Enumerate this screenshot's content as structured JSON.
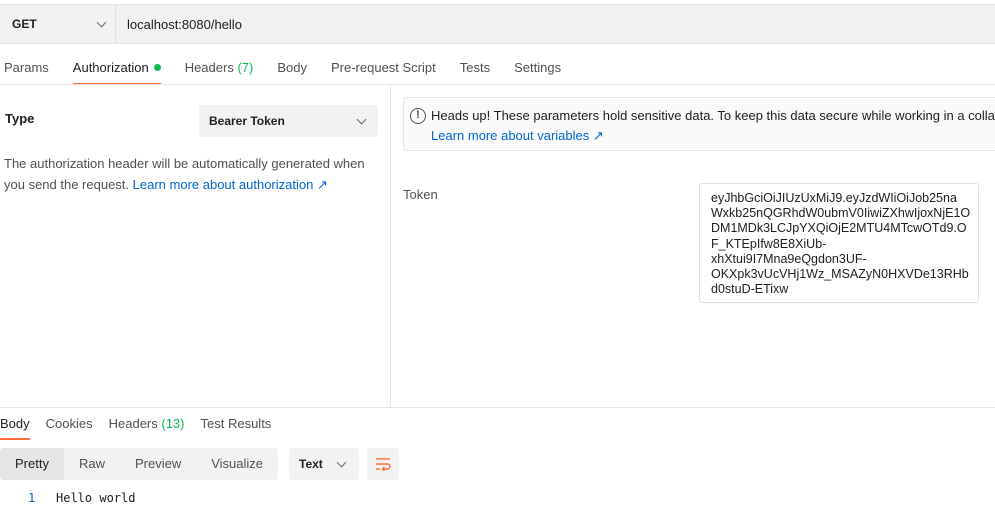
{
  "request": {
    "method": "GET",
    "url": "localhost:8080/hello"
  },
  "request_tabs": [
    {
      "label": "Params",
      "count": ""
    },
    {
      "label": "Authorization",
      "count": ""
    },
    {
      "label": "Headers",
      "count": "(7)"
    },
    {
      "label": "Body",
      "count": ""
    },
    {
      "label": "Pre-request Script",
      "count": ""
    },
    {
      "label": "Tests",
      "count": ""
    },
    {
      "label": "Settings",
      "count": ""
    }
  ],
  "auth": {
    "type_label": "Type",
    "type_value": "Bearer Token",
    "description": "The authorization header will be automatically generated when you send the request.",
    "description_link": "Learn more about authorization ↗"
  },
  "warning": {
    "text": "Heads up! These parameters hold sensitive data. To keep this data secure while working in a collabo",
    "link": "Learn more about variables ↗"
  },
  "token": {
    "label": "Token",
    "lines": [
      "eyJhbGciOiJIUzUxMiJ9.eyJzdWIiOiJob25na",
      "Wxkb25nQGRhdW0ubmV0IiwiZXhwIjoxNjE1O",
      "DM1MDk3LCJpYXQiOjE2MTU4MTcwOTd9.O",
      "F_KTEpIfw8E8XiUb-",
      "xhXtui9I7Mna9eQgdon3UF-",
      "OKXpk3vUcVHj1Wz_MSAZyN0HXVDe13RHb",
      "d0stuD-ETixw"
    ]
  },
  "response_tabs": [
    {
      "label": "Body",
      "count": ""
    },
    {
      "label": "Cookies",
      "count": ""
    },
    {
      "label": "Headers",
      "count": "(13)"
    },
    {
      "label": "Test Results",
      "count": ""
    }
  ],
  "view_modes": [
    "Pretty",
    "Raw",
    "Preview",
    "Visualize"
  ],
  "format": "Text",
  "response_body": {
    "line_number": "1",
    "line_text": "Hello world"
  },
  "colors": {
    "accent": "#ff6c37",
    "success": "#0cbb52",
    "link": "#0265d2"
  }
}
